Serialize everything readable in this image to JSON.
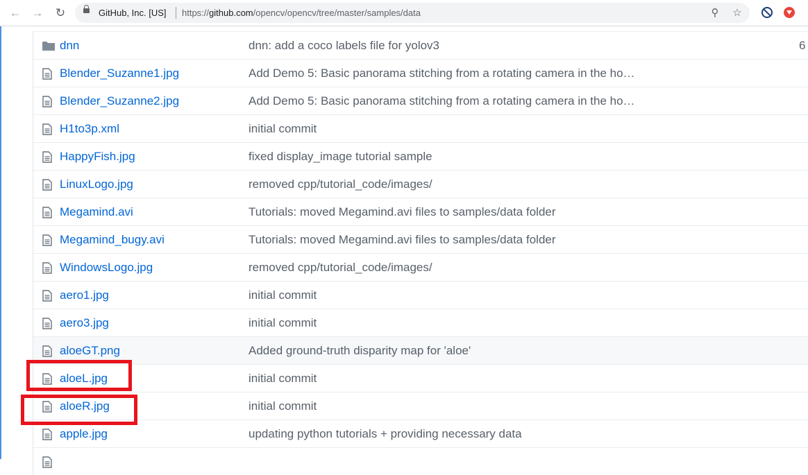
{
  "browser": {
    "org_label": "GitHub, Inc. [US]",
    "url_prefix": "https://",
    "url_host": "github.com",
    "url_path": "/opencv/opencv/tree/master/samples/data"
  },
  "files": [
    {
      "name": "dnn",
      "type": "folder",
      "message": "dnn: add a coco labels file for yolov3",
      "age": "6"
    },
    {
      "name": "Blender_Suzanne1.jpg",
      "type": "file",
      "message": "Add Demo 5: Basic panorama stitching from a rotating camera in the ho…"
    },
    {
      "name": "Blender_Suzanne2.jpg",
      "type": "file",
      "message": "Add Demo 5: Basic panorama stitching from a rotating camera in the ho…"
    },
    {
      "name": "H1to3p.xml",
      "type": "file",
      "message": "initial commit"
    },
    {
      "name": "HappyFish.jpg",
      "type": "file",
      "message": "fixed display_image tutorial sample"
    },
    {
      "name": "LinuxLogo.jpg",
      "type": "file",
      "message": "removed cpp/tutorial_code/images/"
    },
    {
      "name": "Megamind.avi",
      "type": "file",
      "message": "Tutorials: moved Megamind.avi files to samples/data folder"
    },
    {
      "name": "Megamind_bugy.avi",
      "type": "file",
      "message": "Tutorials: moved Megamind.avi files to samples/data folder"
    },
    {
      "name": "WindowsLogo.jpg",
      "type": "file",
      "message": "removed cpp/tutorial_code/images/"
    },
    {
      "name": "aero1.jpg",
      "type": "file",
      "message": "initial commit"
    },
    {
      "name": "aero3.jpg",
      "type": "file",
      "message": "initial commit"
    },
    {
      "name": "aloeGT.png",
      "type": "file",
      "message": "Added ground-truth disparity map for 'aloe'",
      "hover": true
    },
    {
      "name": "aloeL.jpg",
      "type": "file",
      "message": "initial commit",
      "marked": true
    },
    {
      "name": "aloeR.jpg",
      "type": "file",
      "message": "initial commit",
      "marked": true
    },
    {
      "name": "apple.jpg",
      "type": "file",
      "message": "updating python tutorials + providing necessary data"
    },
    {
      "name": "",
      "type": "file",
      "message": ""
    }
  ],
  "colors": {
    "link": "#0366d6",
    "muted": "#586069",
    "annotation": "#e8141d"
  }
}
